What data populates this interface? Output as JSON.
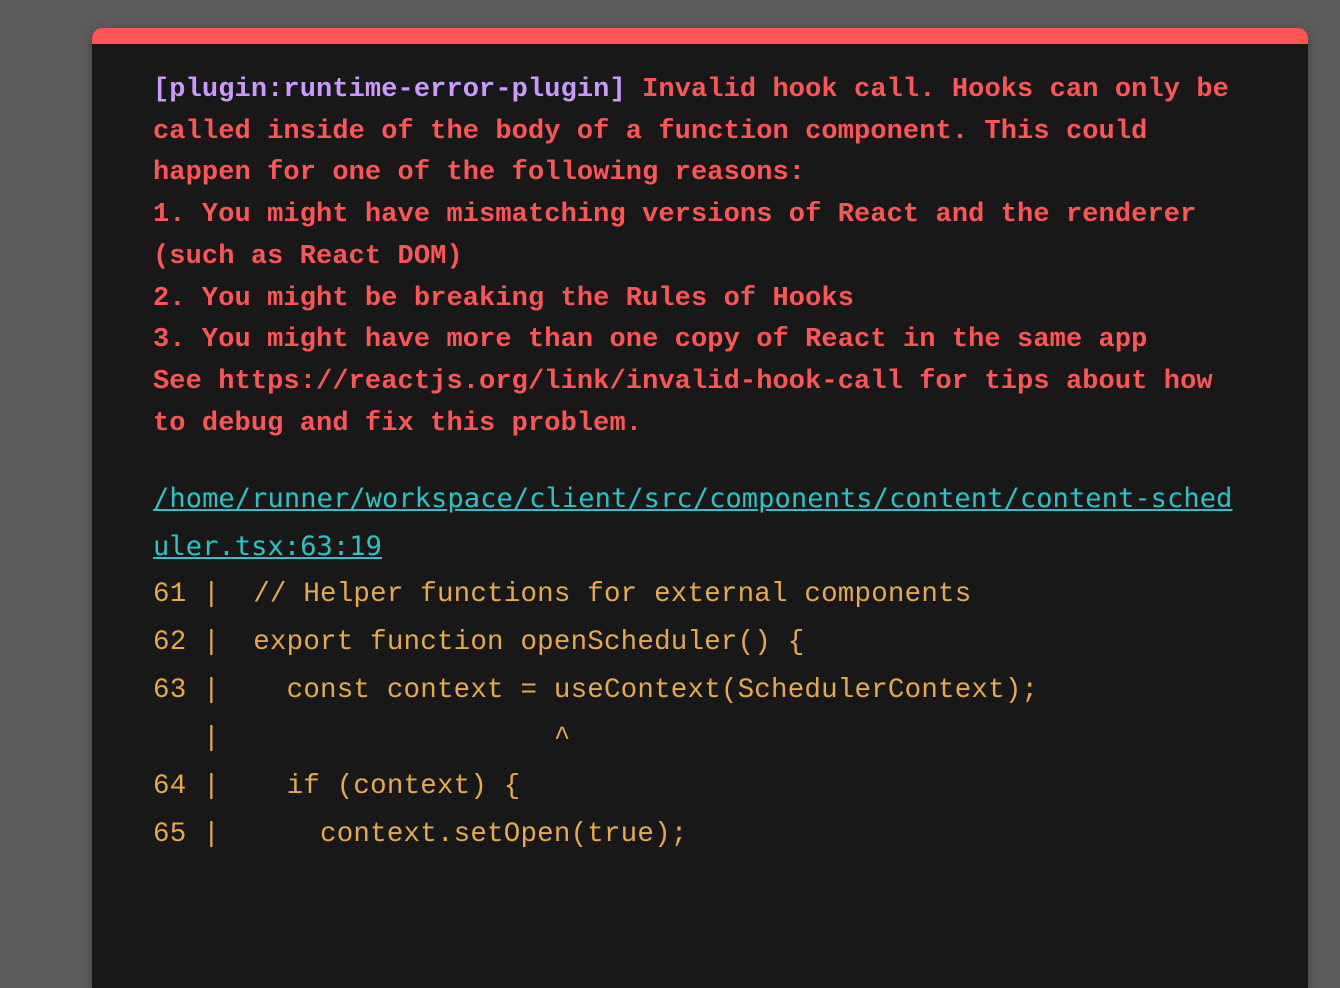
{
  "colors": {
    "background": "#5b5b5b",
    "panel": "#181818",
    "accent_bar": "#ff5555",
    "plugin": "#cc99ff",
    "message": "#ff5555",
    "file_link": "#2bc4c4",
    "code_frame": "#e8a84c"
  },
  "error": {
    "plugin": "[plugin:runtime-error-plugin]",
    "message": " Invalid hook call. Hooks can only be called inside of the body of a function component. This could happen for one of the following reasons:\n1. You might have mismatching versions of React and the renderer (such as React DOM)\n2. You might be breaking the Rules of Hooks\n3. You might have more than one copy of React in the same app\nSee https://reactjs.org/link/invalid-hook-call for tips about how to debug and fix this problem.",
    "file": "/home/runner/workspace/client/src/components/content/content-scheduler.tsx:63:19",
    "frame": "61 |  // Helper functions for external components\n62 |  export function openScheduler() {\n63 |    const context = useContext(SchedulerContext);\n   |                    ^\n64 |    if (context) {\n65 |      context.setOpen(true);"
  }
}
